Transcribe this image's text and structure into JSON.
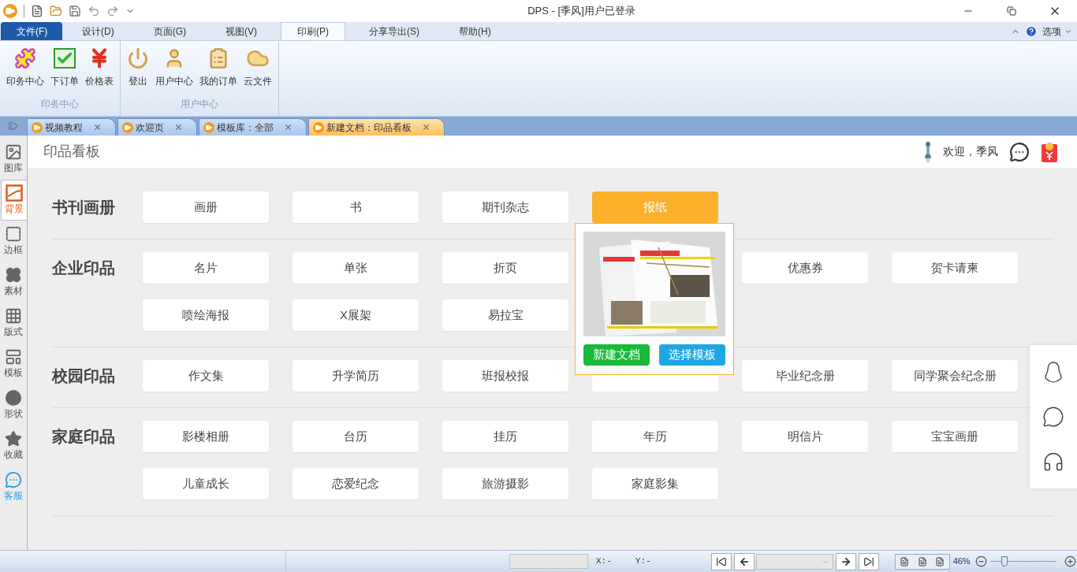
{
  "window": {
    "title": "DPS - [季风]用户已登录"
  },
  "file_menu": "文件(F)",
  "menu_tabs": [
    {
      "label": "设计(D)",
      "selected": false
    },
    {
      "label": "页面(G)",
      "selected": false
    },
    {
      "label": "视图(V)",
      "selected": false
    },
    {
      "label": "印刷(P)",
      "selected": true
    },
    {
      "label": "分享导出(S)",
      "selected": false
    },
    {
      "label": "帮助(H)",
      "selected": false
    }
  ],
  "options_label": "选项",
  "ribbon_groups": [
    {
      "label": "印务中心",
      "buttons": [
        {
          "label": "印务中心",
          "kind": "puzzle"
        },
        {
          "label": "下订单",
          "kind": "check"
        },
        {
          "label": "价格表",
          "kind": "yen"
        }
      ]
    },
    {
      "label": "用户中心",
      "buttons": [
        {
          "label": "登出",
          "kind": "power"
        },
        {
          "label": "用户中心",
          "kind": "user"
        },
        {
          "label": "我的订单",
          "kind": "clipboard"
        },
        {
          "label": "云文件",
          "kind": "cloud"
        }
      ]
    }
  ],
  "doc_tabs": [
    {
      "label": "视频教程",
      "selected": false
    },
    {
      "label": "欢迎页",
      "selected": false
    },
    {
      "label": "模板库：全部",
      "selected": false
    },
    {
      "label": "新建文档：印品看板",
      "selected": true
    }
  ],
  "sidebar": [
    {
      "label": "图库",
      "kind": "gallery",
      "selected": false
    },
    {
      "label": "背景",
      "kind": "background",
      "selected": true
    },
    {
      "label": "边框",
      "kind": "border",
      "selected": false
    },
    {
      "label": "素材",
      "kind": "flower",
      "selected": false
    },
    {
      "label": "版式",
      "kind": "grid",
      "selected": false
    },
    {
      "label": "模板",
      "kind": "template",
      "selected": false
    },
    {
      "label": "形状",
      "kind": "shape",
      "selected": false
    },
    {
      "label": "收藏",
      "kind": "star",
      "selected": false
    },
    {
      "label": "客服",
      "kind": "service",
      "selected": false
    }
  ],
  "page_title": "印品看板",
  "welcome": "欢迎，季风",
  "sections": [
    {
      "title": "书刊画册",
      "items": [
        {
          "label": "画册",
          "selected": false
        },
        {
          "label": "书",
          "selected": false
        },
        {
          "label": "期刊杂志",
          "selected": false
        },
        {
          "label": "报纸",
          "selected": true
        }
      ]
    },
    {
      "title": "企业印品",
      "items": [
        {
          "label": "名片",
          "selected": false
        },
        {
          "label": "单张",
          "selected": false
        },
        {
          "label": "折页",
          "selected": false
        },
        {
          "kind": "covered"
        },
        {
          "label": "优惠券",
          "selected": false
        },
        {
          "label": "贺卡请柬",
          "selected": false
        },
        {
          "label": "喷绘海报",
          "selected": false
        },
        {
          "label": "X展架",
          "selected": false
        },
        {
          "label": "易拉宝",
          "selected": false
        }
      ]
    },
    {
      "title": "校园印品",
      "items": [
        {
          "label": "作文集",
          "selected": false
        },
        {
          "label": "升学简历",
          "selected": false
        },
        {
          "label": "班报校报",
          "selected": false
        },
        {
          "kind": "covered"
        },
        {
          "label": "毕业纪念册",
          "selected": false
        },
        {
          "label": "同学聚会纪念册",
          "selected": false
        }
      ]
    },
    {
      "title": "家庭印品",
      "items": [
        {
          "label": "影楼相册",
          "selected": false
        },
        {
          "label": "台历",
          "selected": false
        },
        {
          "label": "挂历",
          "selected": false
        },
        {
          "label": "年历",
          "selected": false
        },
        {
          "label": "明信片",
          "selected": false
        },
        {
          "label": "宝宝画册",
          "selected": false
        },
        {
          "label": "儿童成长",
          "selected": false
        },
        {
          "label": "恋爱纪念",
          "selected": false
        },
        {
          "label": "旅游摄影",
          "selected": false
        },
        {
          "label": "家庭影集",
          "selected": false
        }
      ]
    }
  ],
  "popup": {
    "buttons": [
      {
        "label": "新建文档",
        "kind": "new"
      },
      {
        "label": "选择模板",
        "kind": "template"
      }
    ]
  },
  "status_bar": {
    "x": "X:-",
    "y": "Y:-",
    "zoom": "46%",
    "zoom_slider": {
      "level": 0.22
    }
  }
}
